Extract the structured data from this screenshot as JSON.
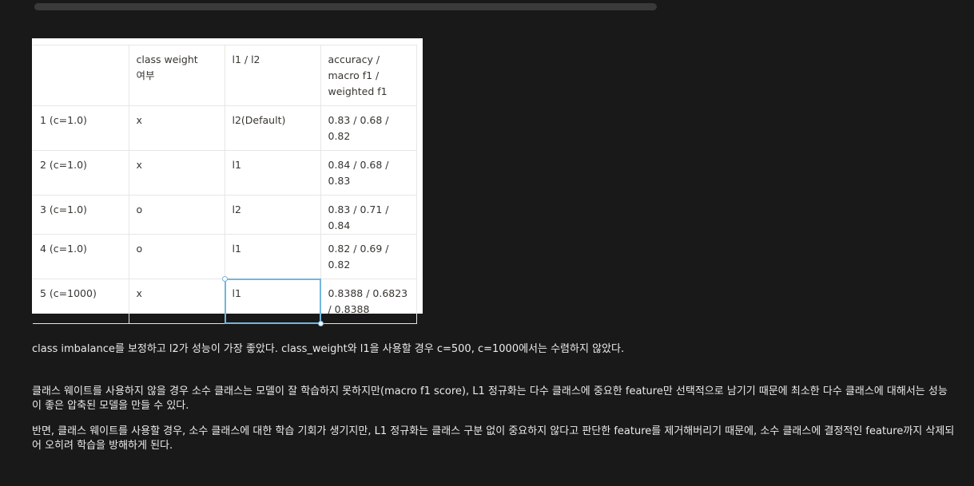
{
  "table": {
    "header": [
      "",
      "class weight 여부",
      "l1 / l2",
      "accuracy / macro f1 / weighted f1"
    ],
    "rows": [
      [
        "1 (c=1.0)",
        "x",
        "l2(Default)",
        "0.83 / 0.68 / 0.82"
      ],
      [
        "2 (c=1.0)",
        "x",
        "l1",
        "0.84 / 0.68 / 0.83"
      ],
      [
        "3 (c=1.0)",
        "o",
        "l2",
        "0.83 / 0.71 / 0.84"
      ],
      [
        "4 (c=1.0)",
        "o",
        "l1",
        "0.82 / 0.69 / 0.82"
      ],
      [
        "5 (c=1000)",
        "x",
        "l1",
        "0.8388 / 0.6823 / 0.8388"
      ]
    ]
  },
  "paragraphs": {
    "p1": "class imbalance를 보정하고 l2가 성능이 가장 좋았다. class_weight와 l1을 사용할 경우 c=500, c=1000에서는 수렴하지 않았다.",
    "p2_line1": "클래스 웨이트를 사용하지 않을 경우 소수 클래스는 모델이 잘 학습하지 못하지만(macro f1 score), L1 정규화는 다수 클래스에 중요한 feature만 선택적으로 남기기 때문에 최소한 다수 클래스에 대해서는 성능",
    "p2_line2": "이 좋은 압축된 모델을 만들 수 있다.",
    "p3_line1": "반면, 클래스 웨이트를 사용할 경우, 소수 클래스에 대한 학습 기회가 생기지만, L1 정규화는 클래스 구분 없이 중요하지 않다고 판단한 feature를 제거해버리기 때문에, 소수 클래스에 결정적인 feature까지 삭제되",
    "p3_line2": "어 오히려 학습을 방해하게 된다."
  },
  "colors": {
    "page_background": "#191919",
    "selection": "#74b6db"
  }
}
